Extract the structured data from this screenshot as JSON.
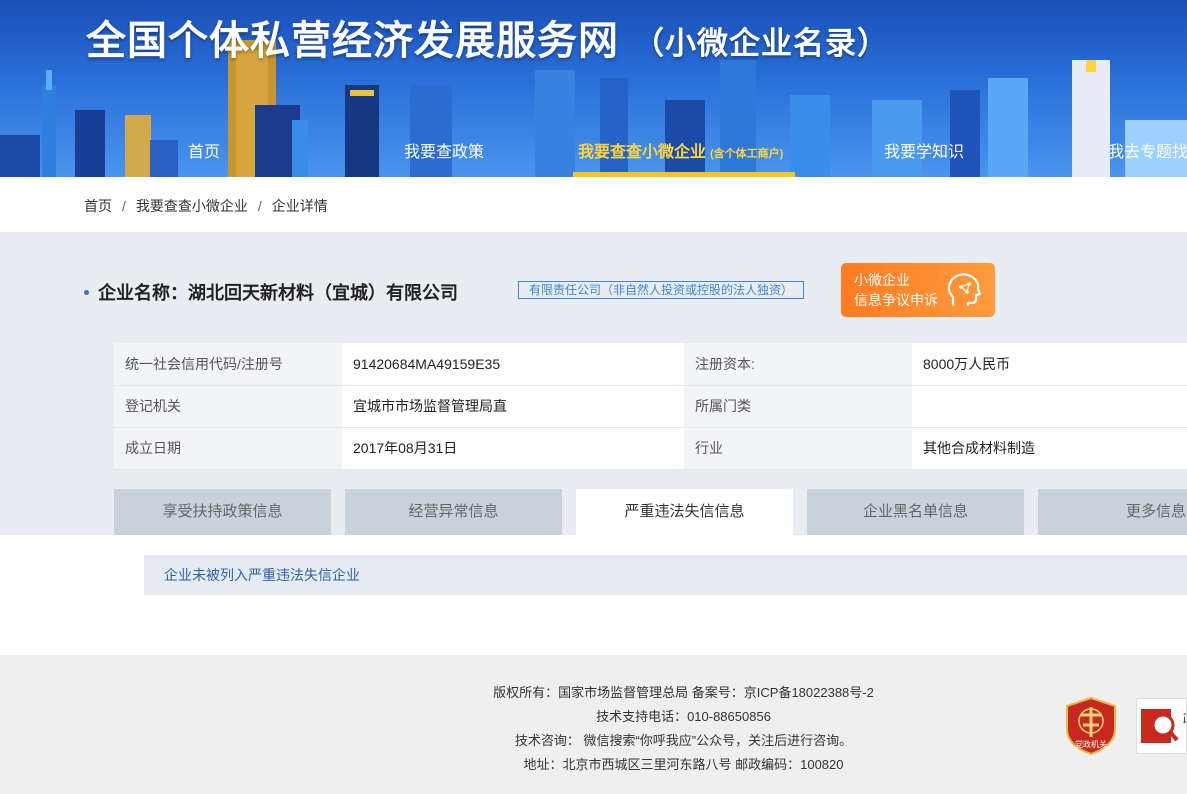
{
  "header": {
    "title": "全国个体私营经济发展服务网",
    "subtitle": "（小微企业名录）"
  },
  "nav": {
    "items": [
      {
        "label": "首页"
      },
      {
        "label": "我要查政策"
      },
      {
        "label": "我要查查小微企业",
        "sub": "(含个体工商户)"
      },
      {
        "label": "我要学知识"
      },
      {
        "label": "我去专题找"
      }
    ]
  },
  "breadcrumb": {
    "items": [
      "首页",
      "我要查查小微企业",
      "企业详情"
    ],
    "separator": "/"
  },
  "company": {
    "label": "企业名称：",
    "name": "湖北回天新材料（宜城）有限公司",
    "type": "有限责任公司（非自然人投资或控股的法人独资）"
  },
  "appeal": {
    "line1": "小微企业",
    "line2": "信息争议申诉"
  },
  "info": {
    "rows": [
      {
        "label1": "统一社会信用代码/注册号",
        "value1": "91420684MA49159E35",
        "label2": "注册资本:",
        "value2": "8000万人民币"
      },
      {
        "label1": "登记机关",
        "value1": "宜城市市场监督管理局直",
        "label2": "所属门类",
        "value2": ""
      },
      {
        "label1": "成立日期",
        "value1": "2017年08月31日",
        "label2": "行业",
        "value2": "其他合成材料制造"
      }
    ]
  },
  "tabs": [
    {
      "label": "享受扶持政策信息"
    },
    {
      "label": "经营异常信息"
    },
    {
      "label": "严重违法失信信息"
    },
    {
      "label": "企业黑名单信息"
    },
    {
      "label": "更多信息"
    }
  ],
  "notice": {
    "text": "企业未被列入严重违法失信企业"
  },
  "footer": {
    "copyright": "版权所有：国家市场监督管理总局 备案号：京ICP备18022388号-2",
    "phone": "技术支持电话：010-88650856",
    "consult": "技术咨询： 微信搜索“你呼我应”公众号，关注后进行咨询。",
    "address": "地址：北京市西城区三里河东路八号 邮政编码：100820",
    "badge_gov_text": "党政机关",
    "badge_right_text": "政"
  },
  "colors": {
    "accent_blue": "#2f79d6",
    "nav_active": "#ffd53b",
    "appeal_orange": "#ff8a2e"
  }
}
